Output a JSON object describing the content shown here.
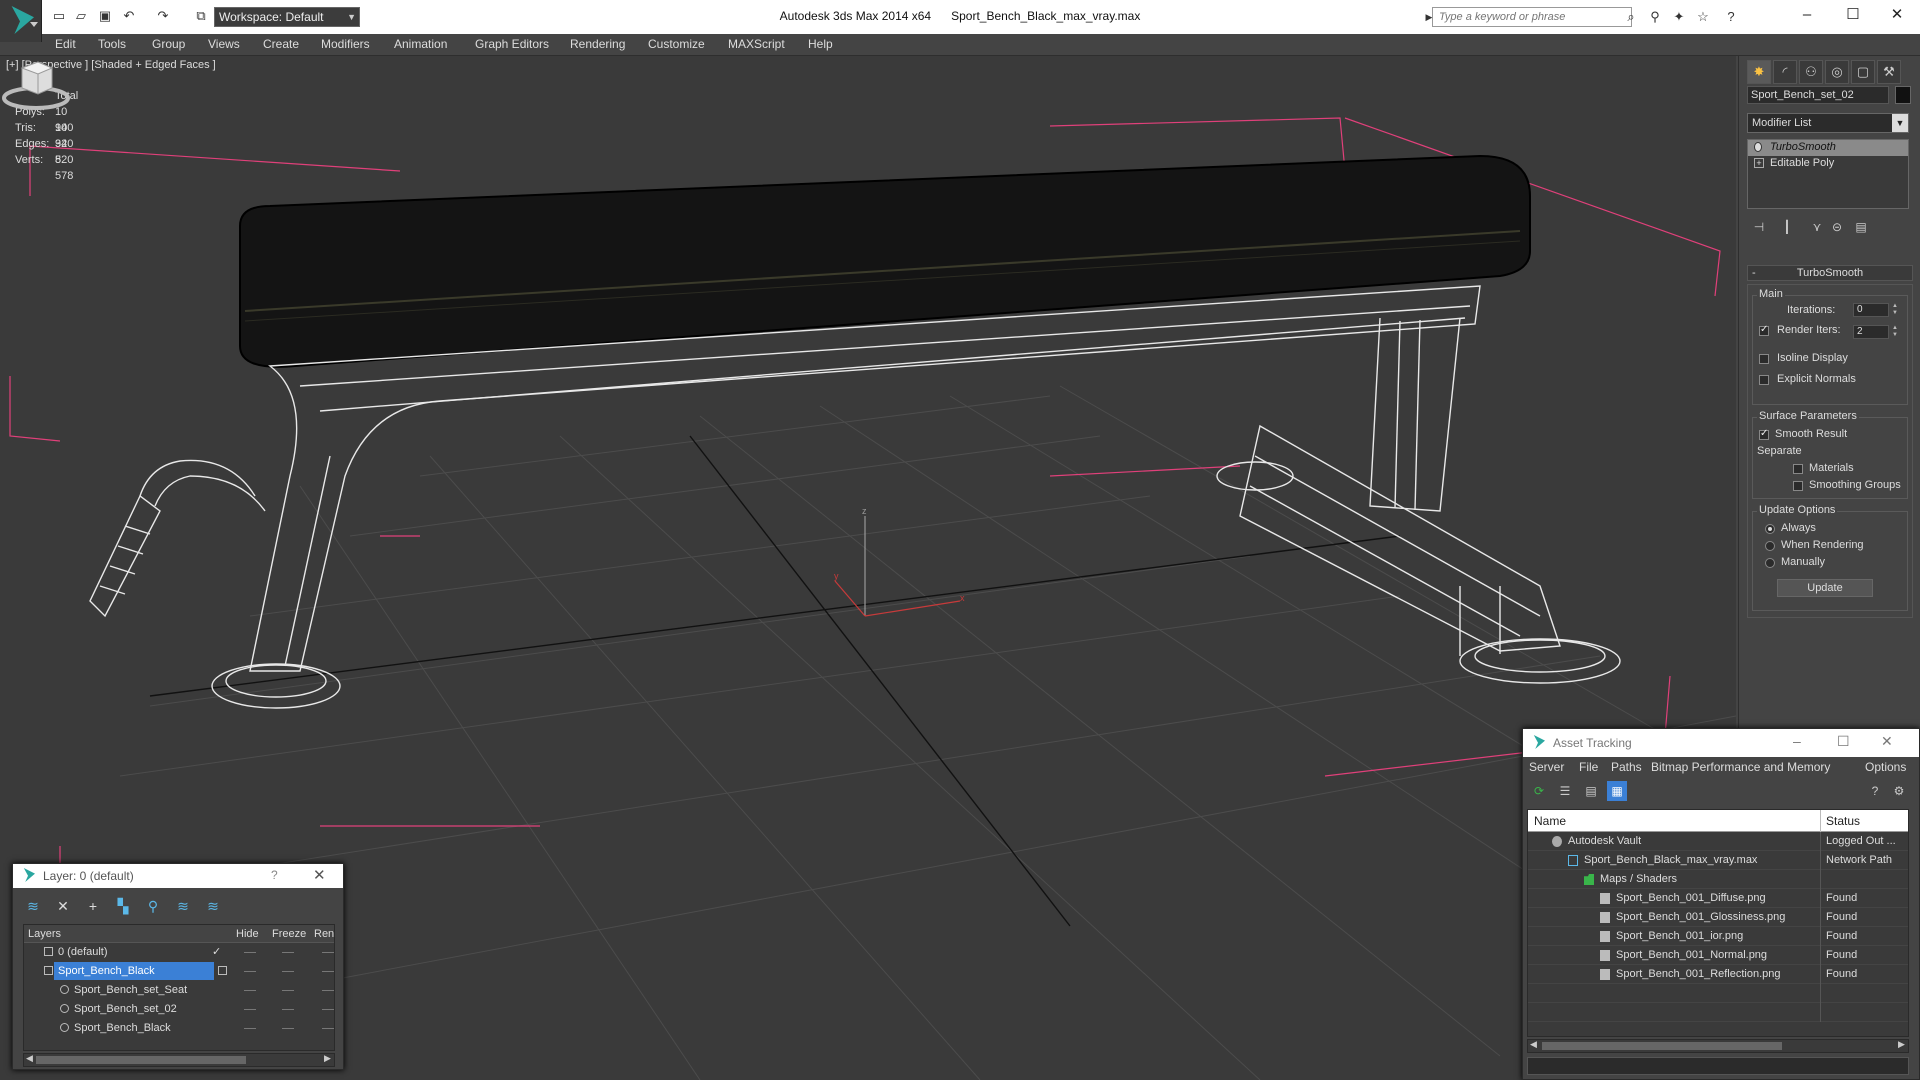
{
  "titlebar": {
    "app_name": "Autodesk 3ds Max  2014 x64",
    "file_name": "Sport_Bench_Black_max_vray.max",
    "workspace": "Workspace: Default",
    "search_placeholder": "Type a keyword or phrase"
  },
  "menus": [
    "Edit",
    "Tools",
    "Group",
    "Views",
    "Create",
    "Modifiers",
    "Animation",
    "Graph Editors",
    "Rendering",
    "Customize",
    "MAXScript",
    "Help"
  ],
  "viewport": {
    "label": "[+] [Perspective ] [Shaded + Edged Faces ]",
    "stats_header": "Total",
    "stats": [
      {
        "key": "Polys:",
        "value": "10 940"
      },
      {
        "key": "Tris:",
        "value": "10 940"
      },
      {
        "key": "Edges:",
        "value": "32 820"
      },
      {
        "key": "Verts:",
        "value": "5 578"
      }
    ],
    "axis_z": "z",
    "axis_x": "x",
    "axis_y": "y"
  },
  "command_panel": {
    "object_name": "Sport_Bench_set_02",
    "modifier_list": "Modifier List",
    "stack": [
      "TurboSmooth",
      "Editable Poly"
    ],
    "rollout_title": "TurboSmooth",
    "main_group": "Main",
    "iterations_label": "Iterations:",
    "iterations_value": "0",
    "render_iters_label": "Render Iters:",
    "render_iters_value": "2",
    "isoline_label": "Isoline Display",
    "explicit_normals_label": "Explicit Normals",
    "surface_group": "Surface Parameters",
    "smooth_result_label": "Smooth Result",
    "separate_label": "Separate",
    "materials_label": "Materials",
    "smoothing_groups_label": "Smoothing Groups",
    "update_group": "Update Options",
    "always_label": "Always",
    "when_rendering_label": "When Rendering",
    "manually_label": "Manually",
    "update_button": "Update"
  },
  "layer_dialog": {
    "title": "Layer: 0 (default)",
    "help": "?",
    "columns": [
      "Layers",
      "Hide",
      "Freeze",
      "Rend"
    ],
    "rows": [
      "0 (default)",
      "Sport_Bench_Black",
      "Sport_Bench_set_Seat",
      "Sport_Bench_set_02",
      "Sport_Bench_Black"
    ]
  },
  "asset_tracking": {
    "title": "Asset Tracking",
    "menus": [
      "Server",
      "File",
      "Paths",
      "Bitmap Performance and Memory",
      "Options"
    ],
    "columns": [
      "Name",
      "Status"
    ],
    "rows": [
      {
        "name": "Autodesk Vault",
        "status": "Logged Out ..."
      },
      {
        "name": "Sport_Bench_Black_max_vray.max",
        "status": "Network Path"
      },
      {
        "name": "Maps / Shaders",
        "status": ""
      },
      {
        "name": "Sport_Bench_001_Diffuse.png",
        "status": "Found"
      },
      {
        "name": "Sport_Bench_001_Glossiness.png",
        "status": "Found"
      },
      {
        "name": "Sport_Bench_001_ior.png",
        "status": "Found"
      },
      {
        "name": "Sport_Bench_001_Normal.png",
        "status": "Found"
      },
      {
        "name": "Sport_Bench_001_Reflection.png",
        "status": "Found"
      }
    ]
  },
  "icons": {
    "close": "close-icon",
    "help": "help-icon",
    "search": "search-icon",
    "minimize": "minimize-icon",
    "maximize": "maximize-icon"
  },
  "colors": {
    "stats_yellow": "#e3e35a",
    "selection_blue": "#3b80d6",
    "bbox_pink": "#e0407a",
    "app_teal": "#2aa7a0"
  }
}
